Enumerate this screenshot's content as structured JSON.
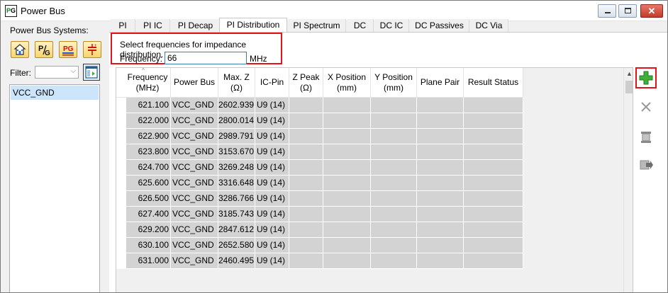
{
  "window": {
    "title": "Power Bus",
    "app_icon_text_p": "P",
    "app_icon_text_g": "G"
  },
  "left": {
    "systems_label": "Power Bus Systems:",
    "filter_label": "Filter:",
    "filter_value": "",
    "buses": [
      "VCC_GND"
    ]
  },
  "tabs": [
    {
      "label": "PI"
    },
    {
      "label": "PI IC"
    },
    {
      "label": "PI Decap"
    },
    {
      "label": "PI Distribution",
      "active": true
    },
    {
      "label": "PI Spectrum"
    },
    {
      "label": "DC"
    },
    {
      "label": "DC IC"
    },
    {
      "label": "DC Passives"
    },
    {
      "label": "DC Via"
    }
  ],
  "frequency_panel": {
    "caption": "Select frequencies for impedance distribution.",
    "label": "Frequency:",
    "value": "66",
    "unit": "MHz"
  },
  "table": {
    "headers": [
      {
        "line1": "Frequency",
        "line2": "(MHz)"
      },
      {
        "line1": "Power Bus",
        "line2": ""
      },
      {
        "line1": "Max. Z",
        "line2": "(Ω)"
      },
      {
        "line1": "IC-Pin",
        "line2": ""
      },
      {
        "line1": "Z Peak",
        "line2": "(Ω)"
      },
      {
        "line1": "X Position",
        "line2": "(mm)"
      },
      {
        "line1": "Y Position",
        "line2": "(mm)"
      },
      {
        "line1": "Plane Pair",
        "line2": ""
      },
      {
        "line1": "Result Status",
        "line2": ""
      }
    ],
    "rows": [
      [
        "621.100",
        "VCC_GND",
        "2602.939",
        "U9 (14)",
        "",
        "",
        "",
        "",
        ""
      ],
      [
        "622.000",
        "VCC_GND",
        "2800.014",
        "U9 (14)",
        "",
        "",
        "",
        "",
        ""
      ],
      [
        "622.900",
        "VCC_GND",
        "2989.791",
        "U9 (14)",
        "",
        "",
        "",
        "",
        ""
      ],
      [
        "623.800",
        "VCC_GND",
        "3153.670",
        "U9 (14)",
        "",
        "",
        "",
        "",
        ""
      ],
      [
        "624.700",
        "VCC_GND",
        "3269.248",
        "U9 (14)",
        "",
        "",
        "",
        "",
        ""
      ],
      [
        "625.600",
        "VCC_GND",
        "3316.648",
        "U9 (14)",
        "",
        "",
        "",
        "",
        ""
      ],
      [
        "626.500",
        "VCC_GND",
        "3286.766",
        "U9 (14)",
        "",
        "",
        "",
        "",
        ""
      ],
      [
        "627.400",
        "VCC_GND",
        "3185.743",
        "U9 (14)",
        "",
        "",
        "",
        "",
        ""
      ],
      [
        "629.200",
        "VCC_GND",
        "2847.612",
        "U9 (14)",
        "",
        "",
        "",
        "",
        ""
      ],
      [
        "630.100",
        "VCC_GND",
        "2652.580",
        "U9 (14)",
        "",
        "",
        "",
        "",
        ""
      ],
      [
        "631.000",
        "VCC_GND",
        "2460.495",
        "U9 (14)",
        "",
        "",
        "",
        "",
        ""
      ]
    ]
  },
  "side_tools": [
    "plus-icon",
    "close-icon",
    "copy-icon",
    "export-icon"
  ],
  "colors": {
    "highlight": "#e2141b",
    "selection": "#cde5fb",
    "cell_bg": "#d3d3d3",
    "add_green": "#3fae3a"
  }
}
